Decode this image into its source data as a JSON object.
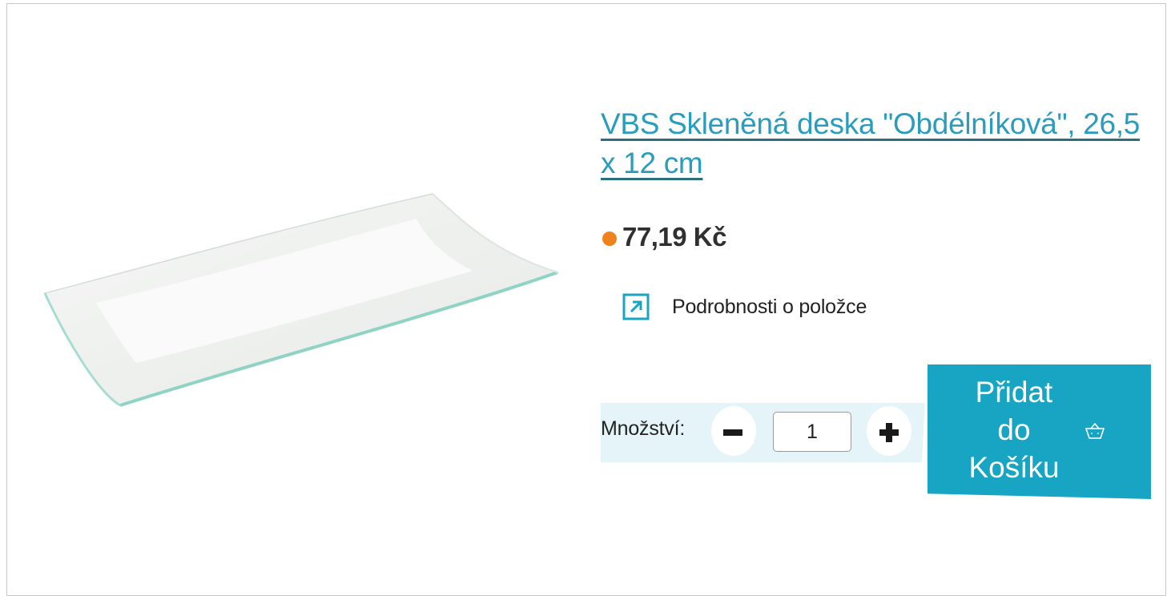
{
  "product": {
    "title": "VBS Skleněná deska \"Obdélníková\", 26,5 x 12 cm",
    "price": "77,19 Kč",
    "availability_color": "#f0821e",
    "details_link": {
      "label": "Podrobnosti o položce",
      "icon": "external-link-arrow-icon"
    },
    "image": {
      "icon": "glass-plate-image"
    }
  },
  "quantity": {
    "label": "Množství:",
    "value": "1",
    "minus_icon": "minus-icon",
    "plus_icon": "plus-icon"
  },
  "cart_button": {
    "label": "Přidat\ndo\nKošíku",
    "icon": "basket-icon"
  },
  "colors": {
    "accent": "#18a5c4",
    "title_link": "#2a9cbd",
    "title_underline": "#2b6f7d",
    "quantity_bg": "#e4f4f9",
    "price_text": "#303030"
  }
}
